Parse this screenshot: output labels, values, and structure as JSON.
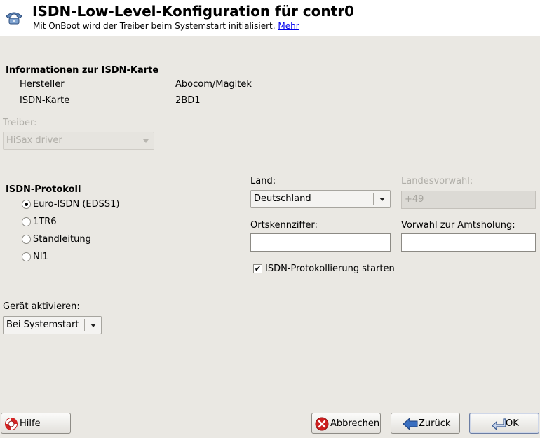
{
  "header": {
    "title": "ISDN-Low-Level-Konfiguration für contr0",
    "subtitle": "Mit OnBoot wird der Treiber beim Systemstart initialisiert.",
    "more_link": "Mehr",
    "icon": "phone-icon"
  },
  "card_info": {
    "heading": "Informationen zur ISDN-Karte",
    "manufacturer_label": "Hersteller",
    "manufacturer_value": "Abocom/Magitek",
    "card_label": "ISDN-Karte",
    "card_value": "2BD1"
  },
  "driver": {
    "label": "Treiber:",
    "value": "HiSax driver"
  },
  "protocol": {
    "heading": "ISDN-Protokoll",
    "options": [
      "Euro-ISDN (EDSS1)",
      "1TR6",
      "Standleitung",
      "NI1"
    ],
    "selected": "Euro-ISDN (EDSS1)"
  },
  "country": {
    "label": "Land:",
    "value": "Deutschland"
  },
  "country_code": {
    "label": "Landesvorwahl:",
    "value": "+49"
  },
  "area_code": {
    "label": "Ortskennziffer:",
    "value": ""
  },
  "dial_prefix": {
    "label": "Vorwahl zur Amtsholung:",
    "value": ""
  },
  "logging": {
    "label": "ISDN-Protokollierung starten",
    "checked": true
  },
  "activate": {
    "label": "Gerät aktivieren:",
    "value": "Bei Systemstart"
  },
  "buttons": {
    "help": "Hilfe",
    "cancel": "Abbrechen",
    "back": "Zurück",
    "ok": "OK"
  }
}
